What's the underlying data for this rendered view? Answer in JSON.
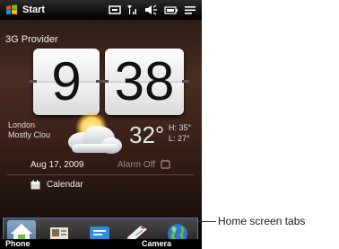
{
  "status_bar": {
    "start_label": "Start",
    "icons": [
      "windows-flag-icon",
      "network-icon",
      "signal-icon",
      "volume-icon",
      "battery-icon",
      "menu-icon"
    ]
  },
  "home": {
    "provider": "3G Provider",
    "clock": {
      "hour": "9",
      "minute": "38"
    },
    "weather": {
      "city": "London",
      "condition": "Mostly Clou",
      "temperature": "32°",
      "high": "H: 35°",
      "low": "L: 27°",
      "icon": "partly-cloudy-icon"
    },
    "date": "Aug 17, 2009",
    "alarm": "Alarm Off",
    "calendar": "Calendar"
  },
  "tabs": [
    {
      "name": "home",
      "icon": "home-icon",
      "selected": true
    },
    {
      "name": "people",
      "icon": "people-icon"
    },
    {
      "name": "messages",
      "icon": "messages-icon"
    },
    {
      "name": "mail",
      "icon": "mail-icon"
    },
    {
      "name": "internet",
      "icon": "globe-icon"
    }
  ],
  "soft_keys": {
    "left": "Phone",
    "right": "Camera"
  },
  "callout": {
    "label": "Home screen tabs"
  },
  "colors": {
    "accent_frame": "#4a6fb0",
    "tab_selected": "#6d8db0"
  }
}
